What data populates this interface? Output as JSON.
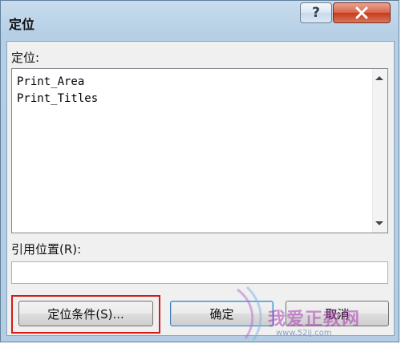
{
  "window": {
    "title": "定位",
    "help_label": "?"
  },
  "goto_list": {
    "label": "定位:",
    "items": [
      "Print_Area",
      "Print_Titles"
    ]
  },
  "reference": {
    "label": "引用位置(R):",
    "value": ""
  },
  "buttons": {
    "special": "定位条件(S)...",
    "ok": "确定",
    "cancel": "取消"
  },
  "watermark": {
    "text": "我爱正教网",
    "url": "www.52ij.com"
  },
  "icons": {
    "help": "help-icon",
    "close": "close-icon",
    "scroll_up": "chevron-up-icon",
    "scroll_down": "chevron-down-icon"
  },
  "colors": {
    "frame": "#b6cfe5",
    "close_button": "#c63a1c",
    "highlight": "#d41a1a",
    "watermark": "#a93bb0"
  }
}
